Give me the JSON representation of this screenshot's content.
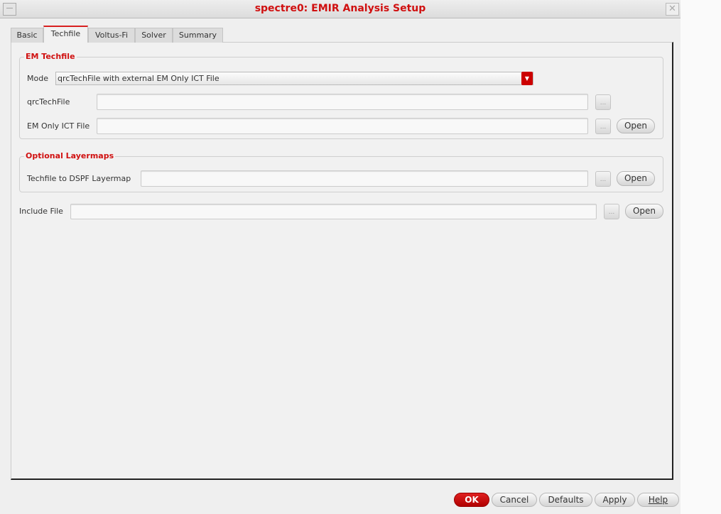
{
  "window": {
    "title": "spectre0: EMIR Analysis Setup",
    "minimize_icon": "minimize-icon",
    "close_icon": "close-icon"
  },
  "tabs": [
    {
      "label": "Basic"
    },
    {
      "label": "Techfile",
      "active": true
    },
    {
      "label": "Voltus-Fi"
    },
    {
      "label": "Solver"
    },
    {
      "label": "Summary"
    }
  ],
  "em_techfile": {
    "title": "EM Techfile",
    "mode_label": "Mode",
    "mode_value": "qrcTechFile with external EM Only ICT File",
    "qrc_label": "qrcTechFile",
    "qrc_value": "",
    "ict_label": "EM Only ICT File",
    "ict_value": "",
    "browse": "...",
    "open": "Open"
  },
  "layermaps": {
    "title": "Optional Layermaps",
    "dspf_label": "Techfile to DSPF Layermap",
    "dspf_value": "",
    "browse": "...",
    "open": "Open"
  },
  "include": {
    "label": "Include File",
    "value": "",
    "browse": "...",
    "open": "Open"
  },
  "buttons": {
    "ok": "OK",
    "cancel": "Cancel",
    "defaults": "Defaults",
    "apply": "Apply",
    "help": "Help"
  },
  "colors": {
    "accent": "#d01010"
  }
}
